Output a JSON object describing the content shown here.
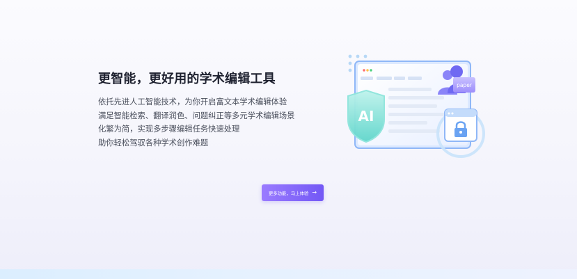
{
  "hero": {
    "title": "更智能，更好用的学术编辑工具",
    "description_lines": [
      "依托先进人工智能技术，为你开启富文本学术编辑体验",
      "满足智能检索、翻译润色、问题纠正等多元学术编辑场景",
      "化繁为简，实现多步骤编辑任务快速处理",
      "助你轻松驾驭各种学术创作难题"
    ],
    "illustration": {
      "shield_text": "AI",
      "tag_text": "paper",
      "icons": [
        "window-icon",
        "ai-shield-icon",
        "user-group-icon",
        "lock-icon"
      ]
    },
    "cta": {
      "label": "更多功能，马上体验",
      "arrow": "→"
    }
  },
  "colors": {
    "accent": "#7358f5",
    "accent_light": "#9a7bff",
    "title": "#1f2230",
    "text": "#4a4f5c"
  }
}
